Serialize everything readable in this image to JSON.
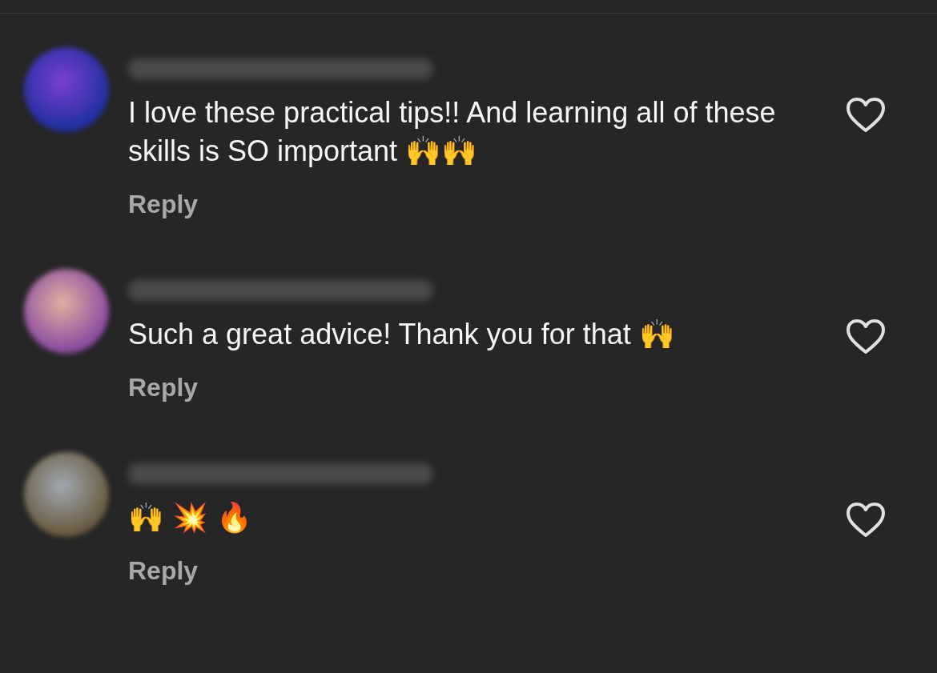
{
  "comments": [
    {
      "text": "I love these practical tips!! And learning all of these skills is SO important 🙌🙌",
      "reply": "Reply",
      "liked": false
    },
    {
      "text": "Such a great advice! Thank you for that 🙌",
      "reply": "Reply",
      "liked": false
    },
    {
      "text": "🙌 💥 🔥",
      "reply": "Reply",
      "liked": false
    }
  ]
}
